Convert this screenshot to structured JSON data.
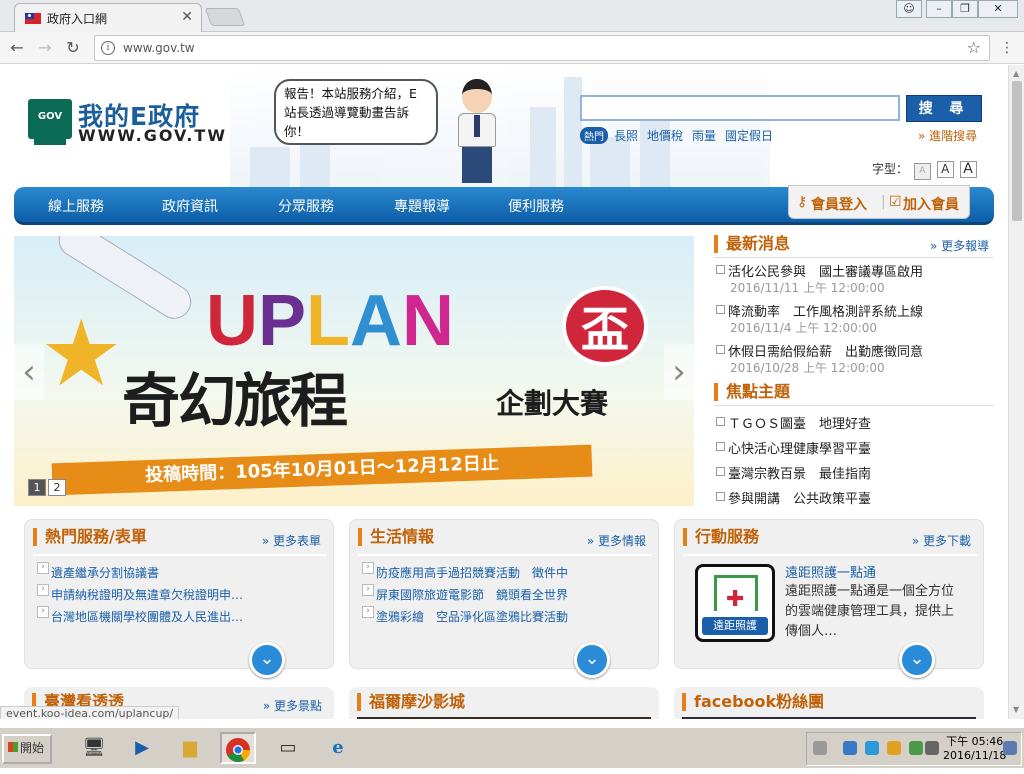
{
  "browser": {
    "tab_title": "政府入口網",
    "tab_close": "✕",
    "url": "www.gov.tw"
  },
  "header": {
    "logo_text": "我的E政府",
    "logo_gov": "GOV",
    "logo_site": "WWW.GOV.TW",
    "bubble_text": "報告！本站服務介紹，E站長透過導覽動畫告訴你！",
    "search_button": "搜 尋",
    "hot_tag": "熱門",
    "hot_keywords": [
      "長照",
      "地價稅",
      "雨量",
      "國定假日"
    ],
    "advanced_search": "» 進階搜尋",
    "font_size_label": "字型：",
    "font_sizes": [
      "A",
      "A",
      "A"
    ]
  },
  "nav": {
    "items": [
      "線上服務",
      "政府資訊",
      "分眾服務",
      "專題報導",
      "便利服務"
    ],
    "login": "會員登入",
    "join": "加入會員"
  },
  "banner": {
    "letters": [
      "U",
      "P",
      "L",
      "A",
      "N"
    ],
    "cup": "盃",
    "subtitle": "奇幻旅程",
    "subtitle2": "企劃大賽",
    "date": "投稿時間：105年10月01日～12月12日止",
    "pages": [
      "1",
      "2"
    ],
    "prev": "‹",
    "next": "›"
  },
  "latest_news": {
    "title": "最新消息",
    "more": "» 更多報導",
    "items": [
      {
        "text": "活化公民參與　國土審議專區啟用",
        "date": "2016/11/11 上午 12:00:00"
      },
      {
        "text": "降流動率　工作風格測評系統上線",
        "date": "2016/11/4 上午 12:00:00"
      },
      {
        "text": "休假日需給假給薪　出勤應徵同意",
        "date": "2016/10/28 上午 12:00:00"
      }
    ]
  },
  "focus": {
    "title": "焦點主題",
    "items": [
      "ＴＧＯＳ圖臺　地理好查",
      "心快活心理健康學習平臺",
      "臺灣宗教百景　最佳指南",
      "參與開講　公共政策平臺"
    ]
  },
  "boxes": [
    {
      "title": "熱門服務/表單",
      "more": "» 更多表單",
      "items": [
        "遺產繼承分割協議書",
        "申請納稅證明及無違章欠稅證明申…",
        "台灣地區機關學校團體及人民進出…"
      ]
    },
    {
      "title": "生活情報",
      "more": "» 更多情報",
      "items": [
        "防疫應用高手過招競賽活動　徵件中",
        "屏東國際旅遊電影節　鏡頭看全世界",
        "塗鴉彩繪　空品淨化區塗鴉比賽活動"
      ]
    },
    {
      "title": "行動服務",
      "more": "» 更多下載",
      "app_title": "遠距照護一點通",
      "app_desc": "遠距照護一點通是一個全方位的雲端健康管理工具，提供上傳個人…",
      "app_label": "遠距照護"
    }
  ],
  "row2": [
    {
      "title": "臺灣看透透",
      "more": "» 更多景點"
    },
    {
      "title": "福爾摩沙影城",
      "more": ""
    },
    {
      "title": "facebook粉絲團",
      "more": ""
    }
  ],
  "status_url": "event.koo-idea.com/uplancup/",
  "taskbar": {
    "start": "開始",
    "clock_line1": "下午 05:46",
    "clock_line2": "2016/11/18"
  },
  "colors": {
    "nav_blue": "#0d5ea8",
    "accent_orange": "#c0620a",
    "link_blue": "#1b5fa8"
  }
}
